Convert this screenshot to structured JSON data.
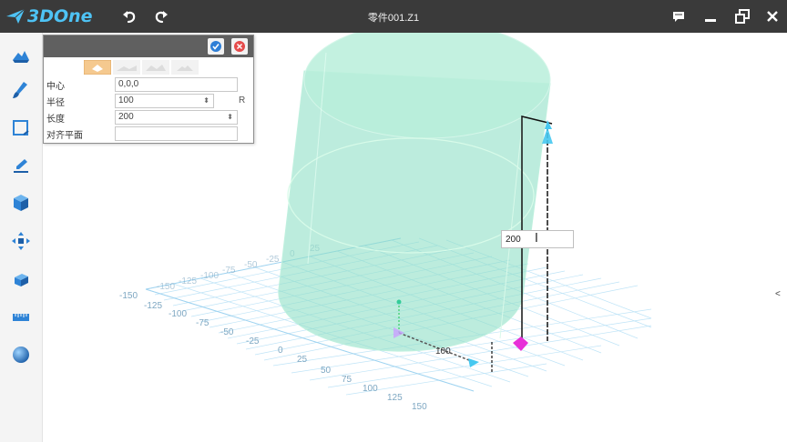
{
  "app": {
    "logo_text": "3DOne",
    "document_title": "零件001.Z1"
  },
  "titlebar": {
    "icons": [
      "undo-icon",
      "redo-icon",
      "comment-icon",
      "minimize-icon",
      "restore-icon",
      "close-icon"
    ]
  },
  "left_toolbar": {
    "icons": [
      "sketch-solid-icon",
      "brush-icon",
      "sketch-plane-icon",
      "pen-edit-icon",
      "cube-icon",
      "move-icon",
      "combine-icon",
      "ruler-icon",
      "sphere-icon"
    ]
  },
  "cylinder_panel": {
    "rows": [
      {
        "label": "中心",
        "value": "0,0,0"
      },
      {
        "label": "半径",
        "value": "100",
        "suffix": "R"
      },
      {
        "label": "长度",
        "value": "200"
      },
      {
        "label": "对齐平面",
        "value": ""
      }
    ]
  },
  "viewport": {
    "dimension_input": "200",
    "radius_label": "100",
    "right_edge_mark": "<",
    "axis_ticks": {
      "left_axis": [
        "-150",
        "-125",
        "-100",
        "-75",
        "-50",
        "-25",
        "0",
        "25",
        "50",
        "75",
        "100",
        "125",
        "150"
      ],
      "back_axis": [
        "-150",
        "-125",
        "-100",
        "-75",
        "-50",
        "-25",
        "0",
        "25"
      ]
    }
  },
  "colors": {
    "titlebar": "#3a3a3a",
    "accent": "#4ec3f5",
    "cylinder_fill": "#8fe0c6",
    "grid": "#9fd3f0"
  }
}
